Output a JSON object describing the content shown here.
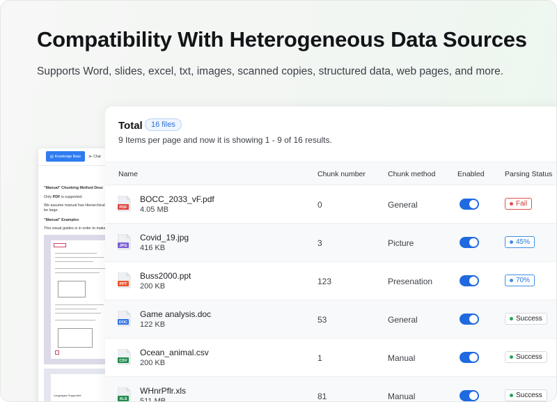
{
  "header": {
    "title": "Compatibility With Heterogeneous Data Sources",
    "subtitle": "Supports Word, slides, excel, txt, images, scanned copies, structured data, web pages, and more."
  },
  "doc_preview": {
    "kb_button": "Knowledge Base",
    "chat_label": "Chat",
    "heading": "\"Manual\" Chunking Method Desc",
    "line1_prefix": "Only ",
    "line1_bold": "PDF",
    "line1_suffix": " is supported.",
    "line2": "We assume manual has Hierarchical sec",
    "line3": "be large.",
    "examples_heading": "\"Manual\" Examples",
    "line4": "This visual guides is in order to make u",
    "sheet_label": "Languages Supported"
  },
  "files_card": {
    "total_label": "Total",
    "count_badge": "16 files",
    "pagination_info": "9 Items per page and now it is showing 1 - 9 of 16 results.",
    "columns": {
      "name": "Name",
      "chunk_number": "Chunk number",
      "chunk_method": "Chunk  method",
      "enabled": "Enabled",
      "parsing_status": "Parsing Status"
    },
    "rows": [
      {
        "name": "BOCC_2033_vF.pdf",
        "size": "4.05 MB",
        "type": "PDF",
        "type_color": "#e0443e",
        "chunks": "0",
        "method": "General",
        "enabled": true,
        "status": "Fail",
        "status_kind": "fail"
      },
      {
        "name": "Covid_19.jpg",
        "size": "416 KB",
        "type": "JPG",
        "type_color": "#7b5cd6",
        "chunks": "3",
        "method": "Picture",
        "enabled": true,
        "status": "45%",
        "status_kind": "progress"
      },
      {
        "name": "Buss2000.ppt",
        "size": "200 KB",
        "type": "PPT",
        "type_color": "#e8552f",
        "chunks": "123",
        "method": "Presenation",
        "enabled": true,
        "status": "70%",
        "status_kind": "progress"
      },
      {
        "name": "Game analysis.doc",
        "size": "122 KB",
        "type": "DOC",
        "type_color": "#2e6fe0",
        "chunks": "53",
        "method": "General",
        "enabled": true,
        "status": "Success",
        "status_kind": "success"
      },
      {
        "name": "Ocean_animal.csv",
        "size": "200 KB",
        "type": "CSV",
        "type_color": "#1e8a4c",
        "chunks": "1",
        "method": "Manual",
        "enabled": true,
        "status": "Success",
        "status_kind": "success"
      },
      {
        "name": "WHnrPflr.xls",
        "size": "511 MB",
        "type": "XLS",
        "type_color": "#1e8a4c",
        "chunks": "81",
        "method": "Manual",
        "enabled": true,
        "status": "Success",
        "status_kind": "success"
      }
    ]
  }
}
